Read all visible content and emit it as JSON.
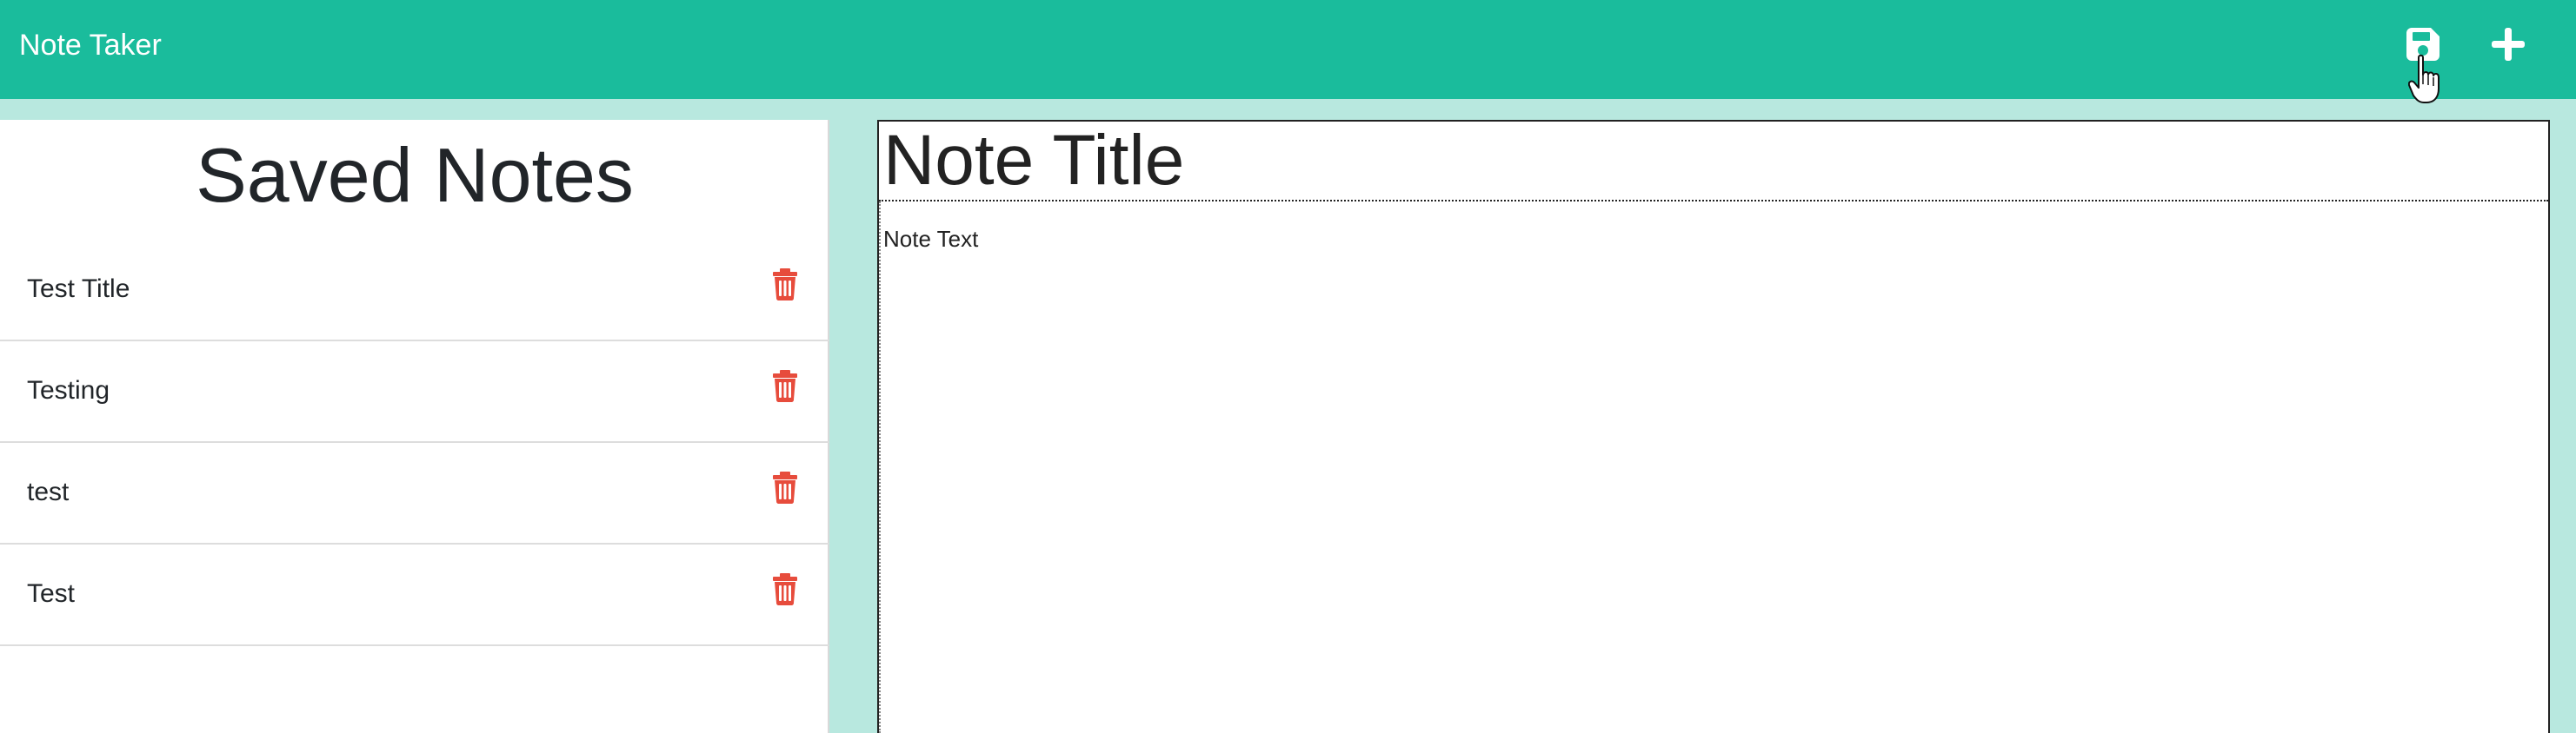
{
  "navbar": {
    "brand": "Note Taker",
    "save_icon": "save-icon",
    "new_note_icon": "plus-icon",
    "background": "#1abc9c"
  },
  "sidebar": {
    "title": "Saved Notes",
    "notes": [
      {
        "title": "Test Title"
      },
      {
        "title": "Testing"
      },
      {
        "title": "test"
      },
      {
        "title": "Test"
      }
    ],
    "delete_icon": "trash-icon",
    "delete_color": "#e74c3c"
  },
  "editor": {
    "title_placeholder": "Note Title",
    "text_placeholder": "Note Text"
  },
  "colors": {
    "page_background": "#b8e8df",
    "text": "#212529"
  }
}
